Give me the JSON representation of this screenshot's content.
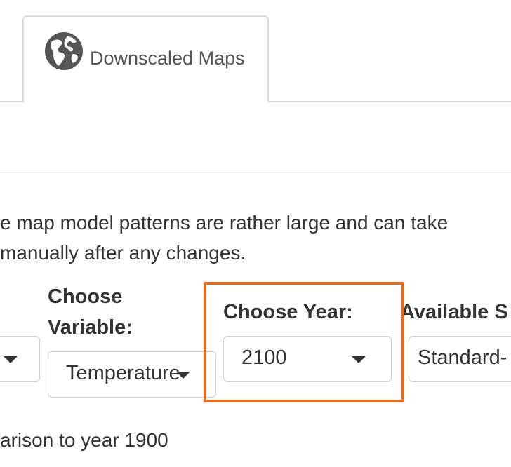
{
  "tabs": [
    {
      "label": "Downscaled Maps",
      "icon": "globe-icon"
    }
  ],
  "info": {
    "line1": "e map model patterns are rather large and can take",
    "line2": " manually after any changes."
  },
  "variable": {
    "label_line1": "Choose",
    "label_line2": "Variable:",
    "selected": "Temperature"
  },
  "year": {
    "label": "Choose Year:",
    "selected": "2100"
  },
  "available": {
    "label": "Available S",
    "selected": "Standard-"
  },
  "footer": {
    "text": "arison to year 1900"
  },
  "colors": {
    "highlight": "#e86a1c",
    "text": "#333333",
    "border": "#dcdcdc"
  }
}
